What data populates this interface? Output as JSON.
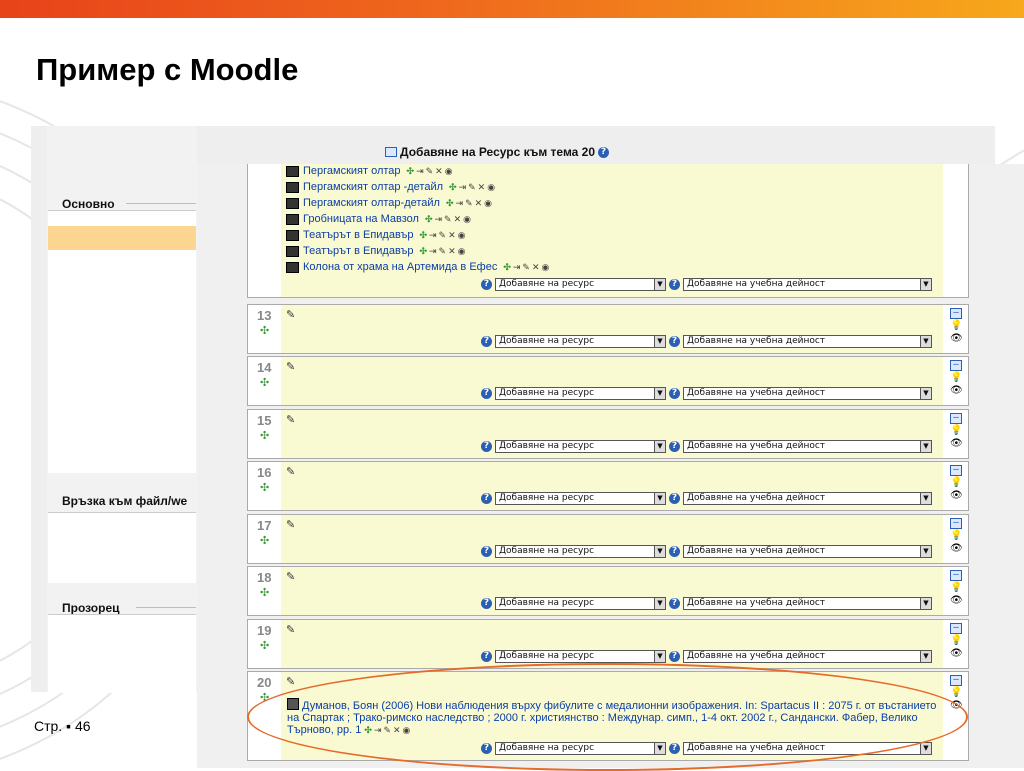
{
  "slide": {
    "title": "Пример с Moodle",
    "page_label": "Стр. ▪ 46"
  },
  "form": {
    "labels": {
      "basic": "Основно",
      "link": "Връзка към файл/we",
      "window": "Прозорец"
    }
  },
  "header": {
    "title": "Добавяне на Ресурс към тема 20"
  },
  "top_section": {
    "resources": [
      "Пергамският олтар",
      "Пергамският олтар -детайл",
      "Пергамският олтар-детайл",
      "Гробницата на Мавзол",
      "Театърът в Епидавър",
      "Театърът в Епидавър",
      "Колона от храма на Артемида в Ефес"
    ]
  },
  "selects": {
    "add_resource": "Добавяне на ресурс",
    "add_activity": "Добавяне на учебна дейност"
  },
  "sections": [
    {
      "num": "13"
    },
    {
      "num": "14"
    },
    {
      "num": "15"
    },
    {
      "num": "16"
    },
    {
      "num": "17"
    },
    {
      "num": "18"
    },
    {
      "num": "19"
    },
    {
      "num": "20",
      "resource_text": "Думанов, Боян (2006) Нови наблюдения върху фибулите с медалионни изображения. In: Spartacus II : 2075 г. от въстанието на Спартак ; Тракo-римско наследство ; 2000 г. християнство : Междунар. симп., 1-4 окт. 2002 г., Сандански. Фабер, Велико Търново, pp. 1"
    }
  ],
  "colors": {
    "topbar_start": "#e8431a",
    "topbar_end": "#f7a81b",
    "section_bg": "#fafad2",
    "link": "#0a3ea6",
    "highlight_oval": "#e66a2a"
  },
  "icons": {
    "edit": "pencil-icon",
    "move": "move-arrows-icon",
    "help": "help-icon",
    "collapse": "collapse-box-icon",
    "highlight": "lightbulb-icon",
    "visibility": "eye-icon",
    "resource": "image-file-icon"
  }
}
